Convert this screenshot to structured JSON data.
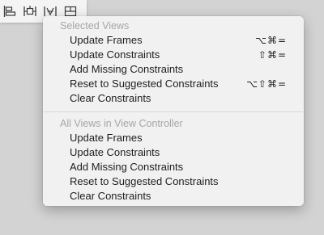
{
  "toolbar": {
    "buttons": [
      {
        "icon": "align-icon"
      },
      {
        "icon": "pin-icon"
      },
      {
        "icon": "resolve-auto-layout-icon"
      },
      {
        "icon": "resizing-behavior-icon"
      }
    ]
  },
  "menu": {
    "selected_views": {
      "header": "Selected Views",
      "items": [
        {
          "label": "Update Frames",
          "shortcut": "⌥⌘="
        },
        {
          "label": "Update Constraints",
          "shortcut": "⇧⌘="
        },
        {
          "label": "Add Missing Constraints",
          "shortcut": ""
        },
        {
          "label": "Reset to Suggested Constraints",
          "shortcut": "⌥⇧⌘="
        },
        {
          "label": "Clear Constraints",
          "shortcut": ""
        }
      ]
    },
    "all_views": {
      "header": "All Views in View Controller",
      "items": [
        {
          "label": "Update Frames"
        },
        {
          "label": "Update Constraints"
        },
        {
          "label": "Add Missing Constraints"
        },
        {
          "label": "Reset to Suggested Constraints"
        },
        {
          "label": "Clear Constraints"
        }
      ]
    }
  }
}
